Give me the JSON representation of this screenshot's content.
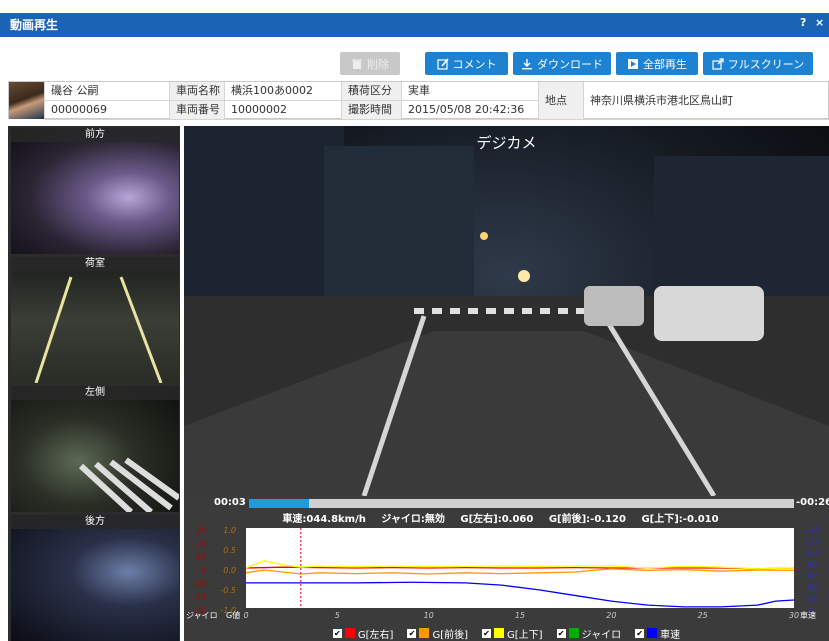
{
  "window": {
    "title": "動画再生",
    "help_label": "?",
    "close_label": "×"
  },
  "toolbar": {
    "delete_label": "削除",
    "comment_label": "コメント",
    "download_label": "ダウンロード",
    "play_all_label": "全部再生",
    "fullscreen_label": "フルスクリーン"
  },
  "info": {
    "driver_name": "磯谷 公嗣",
    "driver_id": "00000069",
    "vehicle_name_label": "車両名称",
    "vehicle_name": "横浜100あ0002",
    "vehicle_number_label": "車両番号",
    "vehicle_number": "10000002",
    "load_label": "積荷区分",
    "load_value": "実車",
    "time_label": "撮影時間",
    "time_value": "2015/05/08 20:42:36",
    "place_label": "地点",
    "place_value": "神奈川県横浜市港北区鳥山町"
  },
  "cameras": [
    {
      "label": "前方"
    },
    {
      "label": "荷室"
    },
    {
      "label": "左側"
    },
    {
      "label": "後方"
    }
  ],
  "main_camera": {
    "label": "デジカメ"
  },
  "playback": {
    "elapsed": "00:03",
    "remaining": "-00:26",
    "progress": 0.11
  },
  "readout": {
    "speed": "車速:044.8km/h",
    "gyro": "ジャイロ:無効",
    "g_lr": "G[左右]:0.060",
    "g_fb": "G[前後]:-0.120",
    "g_ud": "G[上下]:-0.010"
  },
  "chart_data": {
    "type": "line",
    "xlabel": "",
    "x": [
      0,
      5,
      10,
      15,
      20,
      25,
      30
    ],
    "xlim": [
      0,
      30
    ],
    "left_axes": {
      "gyro": {
        "label": "ジャイロ",
        "ticks": [
          "30",
          "20",
          "10",
          "0",
          "-10",
          "-20",
          "-30"
        ]
      },
      "g": {
        "label": "G値",
        "ticks": [
          "1.0",
          "0.5",
          "0.0",
          "-0.5",
          "-1.0"
        ]
      }
    },
    "right_axis": {
      "label": "車速",
      "ticks": [
        "140",
        "120",
        "100",
        "80",
        "60",
        "40",
        "20",
        "0"
      ]
    },
    "cursor_x": 3,
    "series": [
      {
        "name": "G[左右]",
        "color": "#ff0000",
        "axis": "g",
        "x": [
          0,
          2,
          4,
          6,
          8,
          10,
          12,
          14,
          16,
          18,
          20,
          22,
          24,
          26,
          28,
          30
        ],
        "values": [
          0.0,
          0.02,
          0.01,
          0.0,
          0.01,
          0.0,
          0.01,
          0.0,
          0.0,
          0.01,
          0.0,
          0.0,
          0.0,
          0.0,
          -0.02,
          0.0
        ]
      },
      {
        "name": "G[前後]",
        "color": "#ff9900",
        "axis": "g",
        "x": [
          0,
          1,
          2,
          3,
          4,
          6,
          8,
          10,
          12,
          14,
          16,
          18,
          20,
          22,
          24,
          26,
          28,
          30
        ],
        "values": [
          -0.12,
          -0.05,
          -0.1,
          -0.15,
          -0.12,
          -0.14,
          -0.12,
          -0.15,
          -0.12,
          -0.14,
          -0.12,
          -0.1,
          -0.02,
          -0.06,
          -0.04,
          -0.08,
          -0.05,
          -0.06
        ]
      },
      {
        "name": "G[上下]",
        "color": "#ffff00",
        "axis": "g",
        "x": [
          0,
          1,
          2,
          3,
          4,
          6,
          8,
          10,
          12,
          14,
          16,
          18,
          20,
          22,
          24,
          26,
          28,
          30
        ],
        "values": [
          0.0,
          0.18,
          0.08,
          0.02,
          0.05,
          0.03,
          0.05,
          0.03,
          0.04,
          0.05,
          0.04,
          0.05,
          0.05,
          0.0,
          0.04,
          0.02,
          -0.02,
          0.0
        ]
      },
      {
        "name": "ジャイロ",
        "color": "#00b000",
        "axis": "gyro",
        "x": [],
        "values": []
      },
      {
        "name": "車速",
        "color": "#0000ff",
        "axis": "speed",
        "x": [
          0,
          3,
          6,
          9,
          12,
          14,
          16,
          18,
          20,
          22,
          24,
          26,
          28,
          29,
          30
        ],
        "values": [
          44,
          44,
          44,
          45,
          44,
          40,
          32,
          22,
          12,
          5,
          2,
          2,
          5,
          12,
          14
        ]
      }
    ],
    "legend_position": "bottom",
    "grid": false
  }
}
